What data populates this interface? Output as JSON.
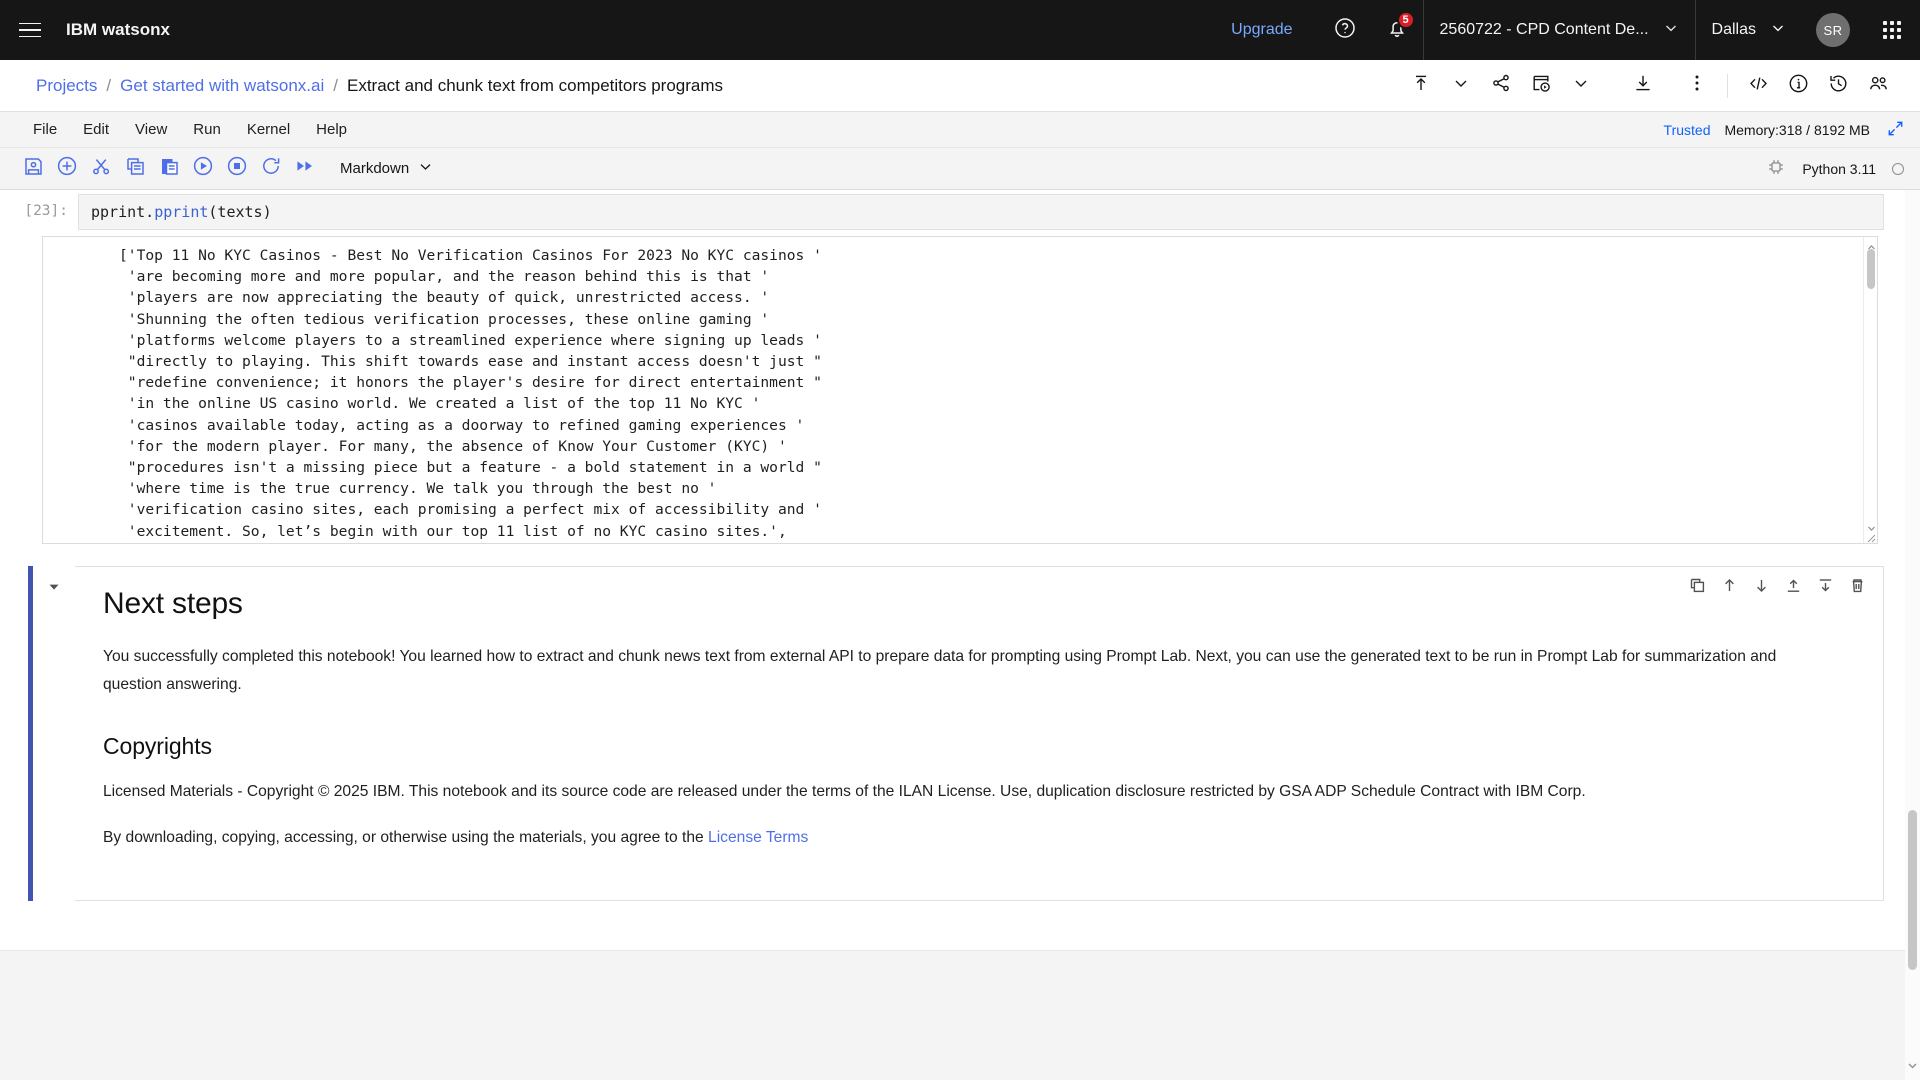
{
  "header": {
    "menu_icon": "hamburger-icon",
    "brand_ibm": "IBM",
    "brand_product": "watsonx",
    "upgrade_label": "Upgrade",
    "help_icon": "help-icon",
    "notifications_icon": "bell-icon",
    "notification_count": "5",
    "account_label": "2560722 - CPD Content De...",
    "region_label": "Dallas",
    "avatar_initials": "SR",
    "app_switcher_icon": "grid-icon"
  },
  "breadcrumb": {
    "projects": "Projects",
    "project": "Get started with watsonx.ai",
    "current": "Extract and chunk text from competitors programs",
    "sep": "/",
    "actions": [
      {
        "name": "promote-icon",
        "title": "Promote"
      },
      {
        "name": "chevron-down-icon",
        "title": "More promote options"
      },
      {
        "name": "share-icon",
        "title": "Share"
      },
      {
        "name": "job-icon",
        "title": "Create job"
      },
      {
        "name": "chevron-down-icon",
        "title": "More job options"
      },
      {
        "name": "download-icon",
        "title": "Download"
      },
      {
        "name": "overflow-menu-icon",
        "title": "More actions"
      },
      {
        "name": "code-icon",
        "title": "Code snippets"
      },
      {
        "name": "info-icon",
        "title": "Information"
      },
      {
        "name": "history-icon",
        "title": "Version history"
      },
      {
        "name": "collaborators-icon",
        "title": "Collaborators"
      }
    ]
  },
  "jupyter": {
    "menus": [
      "File",
      "Edit",
      "View",
      "Run",
      "Kernel",
      "Help"
    ],
    "trusted_label": "Trusted",
    "memory_label": "Memory:318 / 8192 MB",
    "expand_icon": "expand-icon",
    "kernel_label": "Python 3.11",
    "kernel_settings_icon": "kernel-settings-icon",
    "kernel_status_icon": "kernel-idle-icon",
    "toolbar": [
      {
        "name": "save-button",
        "title": "Save"
      },
      {
        "name": "insert-cell-button",
        "title": "Insert cell below"
      },
      {
        "name": "cut-cell-button",
        "title": "Cut cell"
      },
      {
        "name": "copy-cell-button",
        "title": "Copy cell"
      },
      {
        "name": "paste-cell-button",
        "title": "Paste cell"
      },
      {
        "name": "run-cell-button",
        "title": "Run cell"
      },
      {
        "name": "stop-kernel-button",
        "title": "Interrupt kernel"
      },
      {
        "name": "restart-kernel-button",
        "title": "Restart kernel"
      },
      {
        "name": "restart-run-all-button",
        "title": "Restart and run all"
      }
    ],
    "cell_type": "Markdown",
    "cell_type_chevron": "chevron-down-icon"
  },
  "code_cell": {
    "prompt": "[23]:",
    "code_plain": "pprint.pprint(texts)",
    "code_prefix": "pprint.",
    "code_fn": "pprint",
    "code_suffix": "(texts)"
  },
  "output_cell": {
    "text": "['Top 11 No KYC Casinos - Best No Verification Casinos For 2023 No KYC casinos '\n 'are becoming more and more popular, and the reason behind this is that '\n 'players are now appreciating the beauty of quick, unrestricted access. '\n 'Shunning the often tedious verification processes, these online gaming '\n 'platforms welcome players to a streamlined experience where signing up leads '\n \"directly to playing. This shift towards ease and instant access doesn't just \"\n \"redefine convenience; it honors the player's desire for direct entertainment \"\n 'in the online US casino world. We created a list of the top 11 No KYC '\n 'casinos available today, acting as a doorway to refined gaming experiences '\n 'for the modern player. For many, the absence of Know Your Customer (KYC) '\n \"procedures isn't a missing piece but a feature - a bold statement in a world \"\n 'where time is the true currency. We talk you through the best no '\n 'verification casino sites, each promising a perfect mix of accessibility and '\n 'excitement. So, let’s begin with our top 11 list of no KYC casino sites.',\n 'List of Best No Verification Casinos\\n'\n '\\n'\n 'Our team has put together a list of reviewed and approved online casinos '\n 'that have swept the KYC process to one side so that you can enjoy those real '"
  },
  "markdown_cell": {
    "collapse_icon": "caret-down-icon",
    "toolbar": [
      {
        "name": "duplicate-cell-icon",
        "title": "Duplicate cell"
      },
      {
        "name": "move-cell-up-icon",
        "title": "Move cell up"
      },
      {
        "name": "move-cell-down-icon",
        "title": "Move cell down"
      },
      {
        "name": "insert-cell-above-icon",
        "title": "Insert cell above"
      },
      {
        "name": "insert-cell-below-icon",
        "title": "Insert cell below"
      },
      {
        "name": "delete-cell-icon",
        "title": "Delete cell"
      }
    ],
    "heading": "Next steps",
    "paragraph": "You successfully completed this notebook! You learned how to extract and chunk news text from external API to prepare data for prompting using Prompt Lab. Next, you can use the generated text to be run in Prompt Lab for summarization and question answering.",
    "copyrights_heading": "Copyrights",
    "copyright_paragraph": "Licensed Materials - Copyright © 2025 IBM. This notebook and its source code are released under the terms of the ILAN License. Use, duplication disclosure restricted by GSA ADP Schedule Contract with IBM Corp.",
    "license_lead": "By downloading, copying, accessing, or otherwise using the materials, you agree to the ",
    "license_link": "License Terms"
  },
  "colors": {
    "header_bg": "#161616",
    "accent_blue": "#4f6fe8",
    "link_blue": "#78a9ff",
    "badge_red": "#da1e28",
    "markdown_bar": "#4353b0",
    "trusted_blue": "#0f62fe"
  }
}
